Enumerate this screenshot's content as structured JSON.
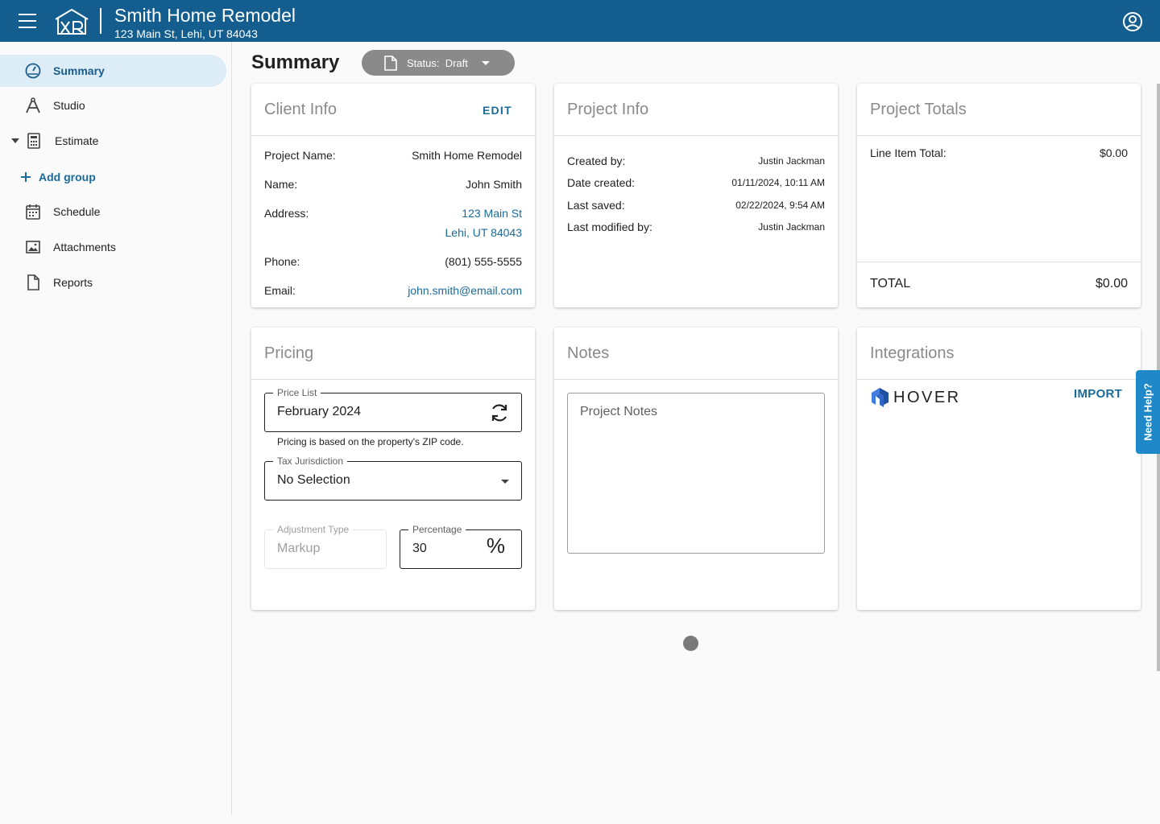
{
  "header": {
    "title": "Smith Home Remodel",
    "subtitle": "123 Main St, Lehi, UT 84043",
    "logo_text": "XR",
    "menu_icon": "hamburger-menu-icon",
    "account_icon": "account-circle-icon",
    "bar_color": "#135e8e"
  },
  "sidebar": {
    "items": [
      {
        "label": "Summary",
        "icon": "dashboard-gauge-icon",
        "active": true
      },
      {
        "label": "Studio",
        "icon": "studio-compass-icon"
      },
      {
        "label": "Estimate",
        "icon": "calculator-icon",
        "expanded": true
      },
      {
        "label": "Add group",
        "icon": "plus-icon"
      },
      {
        "label": "Schedule",
        "icon": "calendar-icon"
      },
      {
        "label": "Attachments",
        "icon": "image-icon"
      },
      {
        "label": "Reports",
        "icon": "document-icon"
      }
    ]
  },
  "page": {
    "title": "Summary",
    "status_label": "Status:",
    "status_value": "Draft"
  },
  "client_info": {
    "title": "Client Info",
    "action": "EDIT",
    "rows": [
      {
        "label": "Project Name:",
        "value": "Smith Home Remodel"
      },
      {
        "label": "Name:",
        "value": "John Smith"
      },
      {
        "label": "Address:",
        "value_line1": "123 Main St",
        "value_line2": "Lehi, UT 84043"
      },
      {
        "label": "Phone:",
        "value": "(801) 555-5555"
      },
      {
        "label": "Email:",
        "value": "john.smith@email.com"
      }
    ]
  },
  "project_info": {
    "title": "Project Info",
    "rows": [
      {
        "label": "Created by:",
        "value": "Justin Jackman"
      },
      {
        "label": "Date created:",
        "value": "01/11/2024, 10:11 AM"
      },
      {
        "label": "Last saved:",
        "value": "02/22/2024, 9:54 AM"
      },
      {
        "label": "Last modified by:",
        "value": "Justin Jackman"
      }
    ]
  },
  "project_totals": {
    "title": "Project Totals",
    "line_item_label": "Line Item Total:",
    "line_item_value": "$0.00",
    "total_label": "TOTAL",
    "total_value": "$0.00"
  },
  "pricing": {
    "title": "Pricing",
    "price_list_label": "Price List",
    "price_list_value": "February 2024",
    "price_list_helper": "Pricing is based on the property's ZIP code.",
    "tax_label": "Tax Jurisdiction",
    "tax_value": "No Selection",
    "adjustment_label": "Adjustment Type",
    "adjustment_value": "Markup",
    "percentage_label": "Percentage",
    "percentage_value": "30",
    "percentage_symbol": "%"
  },
  "notes": {
    "title": "Notes",
    "placeholder": "Project Notes"
  },
  "integrations": {
    "title": "Integrations",
    "provider": "HOVER",
    "action": "IMPORT"
  },
  "help_tab": {
    "label": "Need Help?",
    "color": "#1e88c9"
  }
}
